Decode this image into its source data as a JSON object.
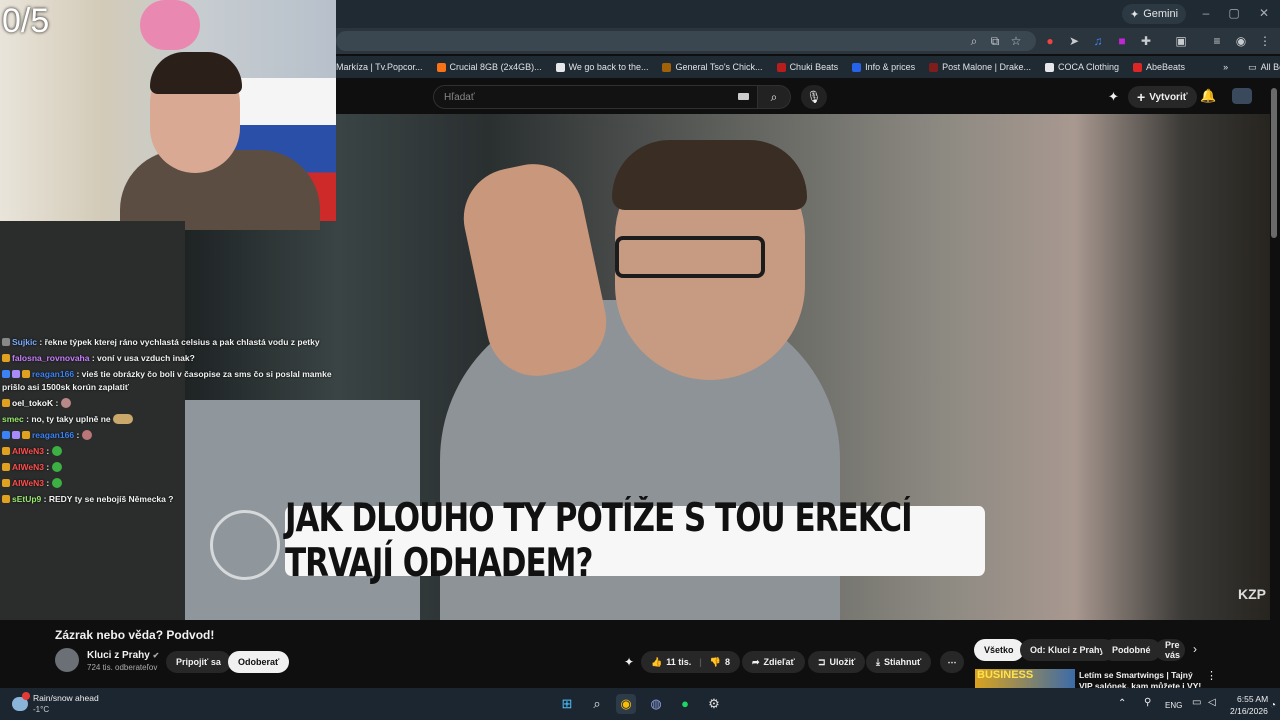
{
  "browser": {
    "gemini_label": "Gemini",
    "bookmarks": [
      {
        "label": "Markíza | Tv.Popcor...",
        "color": "#3b82f6"
      },
      {
        "label": "Crucial 8GB (2x4GB)...",
        "color": "#f97316"
      },
      {
        "label": "We go back to the...",
        "color": "#e5e7eb"
      },
      {
        "label": "General Tso's Chick...",
        "color": "#a16207"
      },
      {
        "label": "Chuki Beats",
        "color": "#b91c1c"
      },
      {
        "label": "Info & prices",
        "color": "#2563eb"
      },
      {
        "label": "Post Malone | Drake...",
        "color": "#7f1d1d"
      },
      {
        "label": "COCA Clothing",
        "color": "#e5e7eb"
      },
      {
        "label": "AbeBeats",
        "color": "#dc2626"
      }
    ],
    "all_bookmarks": "All Bookmarks"
  },
  "youtube": {
    "search_placeholder": "Hľadať",
    "create_label": "Vytvoriť",
    "subtitle": "JAK DLOUHO TY POTÍŽE S TOU EREKCÍ TRVAJÍ ODHADEM?",
    "watermark": "KZP",
    "video_title": "Zázrak nebo věda? Podvod!",
    "channel_name": "Kluci z Prahy",
    "channel_subs": "724 tis. odberateľov",
    "join_label": "Pripojiť sa",
    "subscribe_label": "Odoberať",
    "like_count": "11 tis.",
    "dislike_count": "8",
    "share_label": "Zdieľať",
    "save_label": "Uložiť",
    "download_label": "Stiahnuť",
    "chips": [
      "Všetko",
      "Od: Kluci z Prahy",
      "Podobné",
      "Pre vás"
    ],
    "rec_thumb_text": "BUSINESS",
    "rec_title": "Letím se Smartwings | Tajný VIP salónek, kam můžete i VY!"
  },
  "stream": {
    "counter": "0/5",
    "chat": [
      {
        "user": "Sujkic",
        "color": "#7aa7ff",
        "text": ": řekne týpek kterej ráno vychlastá celsius a pak chlastá vodu z petky"
      },
      {
        "user": "falosna_rovnovaha",
        "color": "#c77dff",
        "text": ": voní v usa vzduch inak?"
      },
      {
        "user": "reagan166",
        "color": "#3b82f6",
        "text": ": vieš tie obrázky čo boli v časopise za sms čo si poslal mamke prišlo asi 1500sk korún zaplatiť"
      },
      {
        "user": "oel_tokoK",
        "color": "#ffffff",
        "text": ":"
      },
      {
        "user": "smec",
        "color": "#9ae66e",
        "text": ": no, ty taky uplně ne"
      },
      {
        "user": "reagan166",
        "color": "#3b82f6",
        "text": ":"
      },
      {
        "user": "AIWeN3",
        "color": "#ff4d4d",
        "text": ":"
      },
      {
        "user": "AIWeN3",
        "color": "#ff4d4d",
        "text": ":"
      },
      {
        "user": "AIWeN3",
        "color": "#ff4d4d",
        "text": ":"
      },
      {
        "user": "sEtUp9",
        "color": "#9ae66e",
        "text": ": REDY ty se nebojíš Německa ?"
      }
    ]
  },
  "taskbar": {
    "weather_title": "Rain/snow ahead",
    "weather_temp": "-1°C",
    "lang": "ENG",
    "time": "6:55 AM",
    "date": "2/16/2026"
  }
}
